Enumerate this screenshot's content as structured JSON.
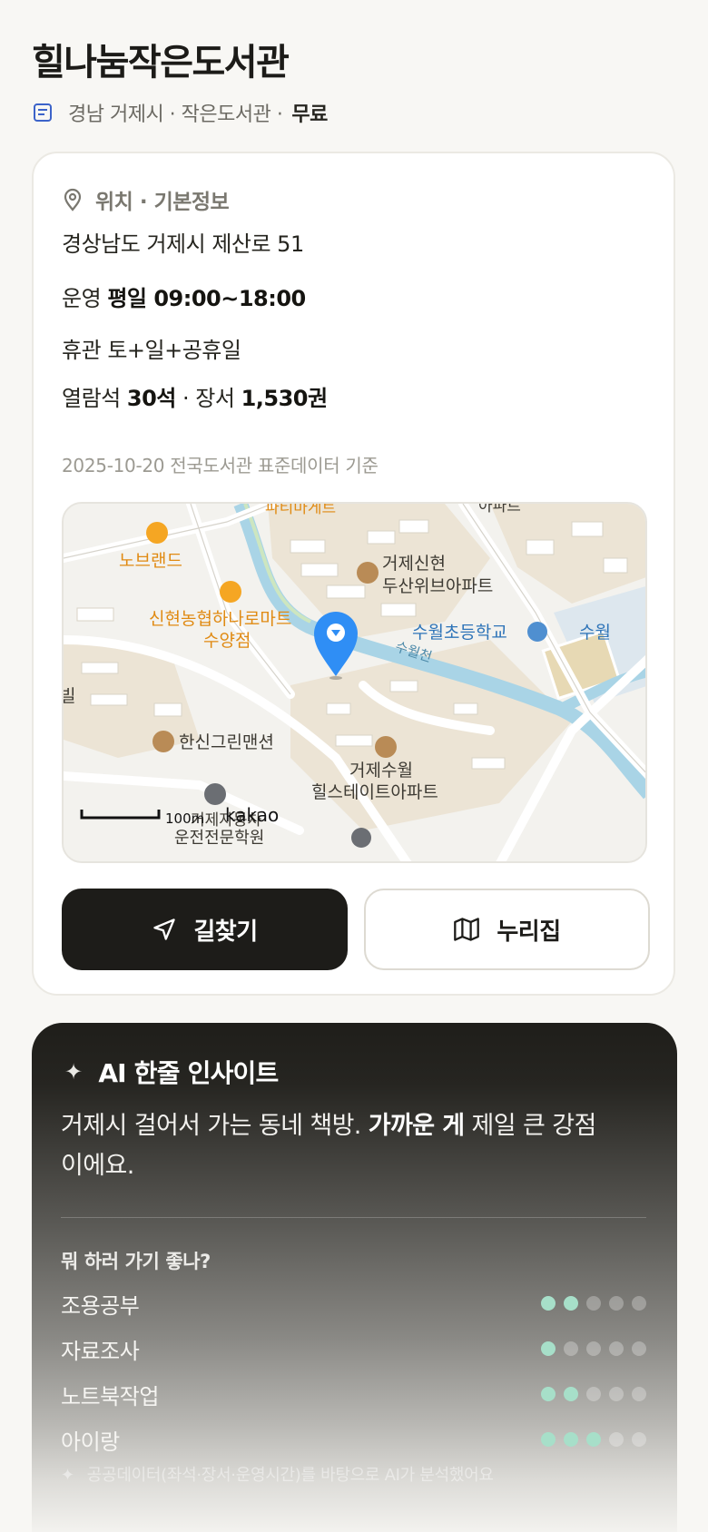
{
  "header": {
    "title": "힐나눔작은도서관",
    "region": "경남 거제시 · 작은도서관 ·",
    "fee": "무료"
  },
  "info_card": {
    "section_title": "위치 · 기본정보",
    "address": "경상남도 거제시 제산로 51",
    "hours_label": "운영",
    "hours_value": "평일 09:00~18:00",
    "closed_label": "휴관",
    "closed_value": "토+일+공휴일",
    "seats_label": "열람석",
    "seats_value": "30석",
    "books_label": "· 장서",
    "books_value": "1,530권",
    "source": "2025-10-20 전국도서관 표준데이터 기준"
  },
  "map": {
    "labels": {
      "nobrand": "노브랜드",
      "mart_1": "신현농협하나로마트",
      "mart_2": "수양점",
      "apt1_1": "거제신현",
      "apt1_2": "두산위브아파트",
      "school": "수월초등학교",
      "school_cut": "수월",
      "stream": "수월천",
      "hanshin": "한신그린맨션",
      "apt2_1": "거제수월",
      "apt2_2": "힐스테이트아파트",
      "top_cut": "파티마게트",
      "top_right_cut": "아파트",
      "left_cut": "빌",
      "bottom_cut": "운전전문학원",
      "scale": "100m",
      "kakao": "kakao",
      "bottom_mid": "거제자동차"
    }
  },
  "buttons": {
    "directions": "길찾기",
    "nurizip": "누리집"
  },
  "ai": {
    "title": "AI 한줄 인사이트",
    "insight_pre": "거제시 걸어서 가는 동네 책방. ",
    "insight_bold": "가까운 게",
    "insight_post": " 제일 큰 강점이에요.",
    "question": "뭐 하러 가기 좋나?",
    "ratings": [
      {
        "label": "조용공부",
        "score": 2,
        "max": 5
      },
      {
        "label": "자료조사",
        "score": 1,
        "max": 5
      },
      {
        "label": "노트북작업",
        "score": 2,
        "max": 5
      },
      {
        "label": "아이랑",
        "score": 3,
        "max": 5
      }
    ],
    "footnote": "공공데이터(좌석·장서·운영시간)를 바탕으로 AI가 분석했어요"
  },
  "colors": {
    "accent_dot": "#a7dfc9",
    "map_pin": "#2f8ef5",
    "poi_orange": "#f5a623",
    "poi_brown": "#b98b56"
  }
}
